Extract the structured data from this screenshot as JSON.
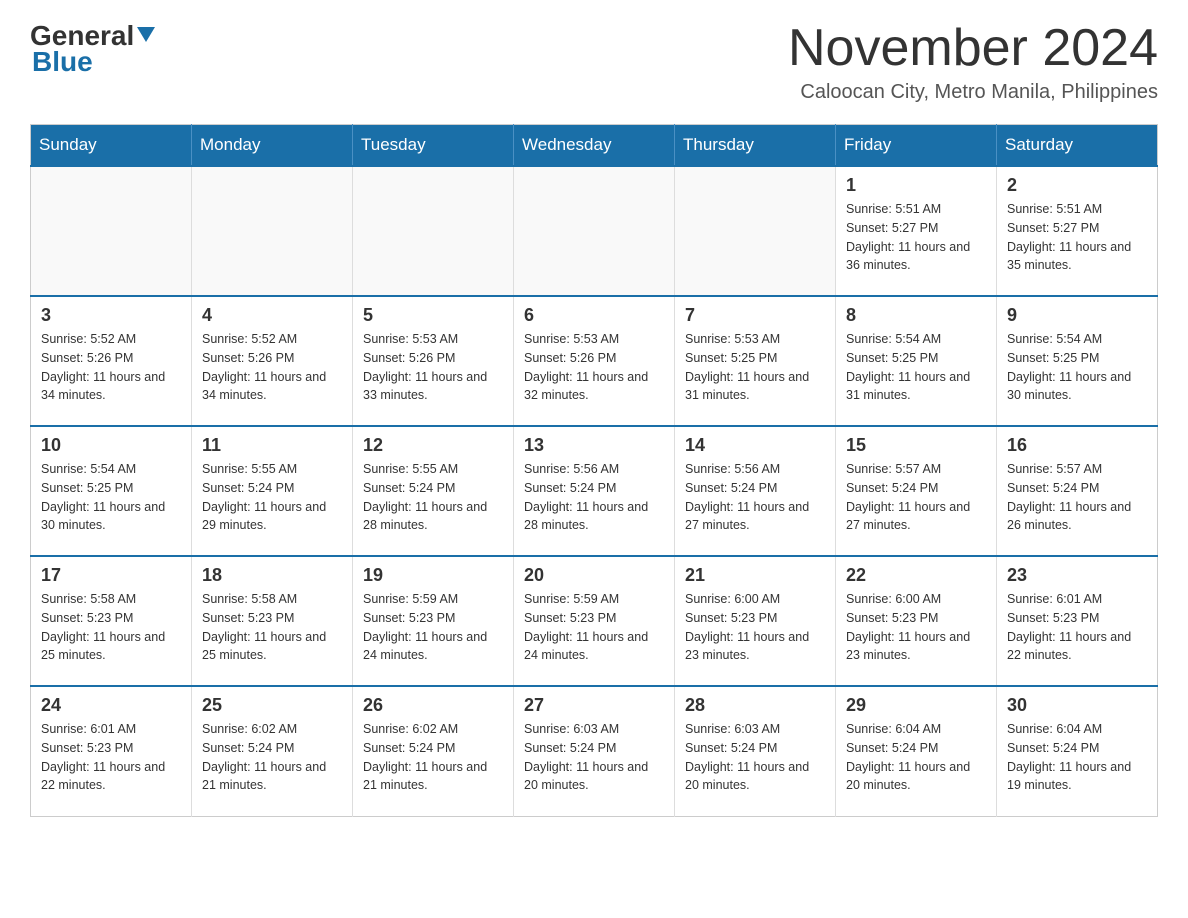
{
  "logo": {
    "text_general": "General",
    "text_blue": "Blue"
  },
  "title": "November 2024",
  "subtitle": "Caloocan City, Metro Manila, Philippines",
  "weekdays": [
    "Sunday",
    "Monday",
    "Tuesday",
    "Wednesday",
    "Thursday",
    "Friday",
    "Saturday"
  ],
  "weeks": [
    [
      {
        "day": "",
        "info": ""
      },
      {
        "day": "",
        "info": ""
      },
      {
        "day": "",
        "info": ""
      },
      {
        "day": "",
        "info": ""
      },
      {
        "day": "",
        "info": ""
      },
      {
        "day": "1",
        "info": "Sunrise: 5:51 AM\nSunset: 5:27 PM\nDaylight: 11 hours and 36 minutes."
      },
      {
        "day": "2",
        "info": "Sunrise: 5:51 AM\nSunset: 5:27 PM\nDaylight: 11 hours and 35 minutes."
      }
    ],
    [
      {
        "day": "3",
        "info": "Sunrise: 5:52 AM\nSunset: 5:26 PM\nDaylight: 11 hours and 34 minutes."
      },
      {
        "day": "4",
        "info": "Sunrise: 5:52 AM\nSunset: 5:26 PM\nDaylight: 11 hours and 34 minutes."
      },
      {
        "day": "5",
        "info": "Sunrise: 5:53 AM\nSunset: 5:26 PM\nDaylight: 11 hours and 33 minutes."
      },
      {
        "day": "6",
        "info": "Sunrise: 5:53 AM\nSunset: 5:26 PM\nDaylight: 11 hours and 32 minutes."
      },
      {
        "day": "7",
        "info": "Sunrise: 5:53 AM\nSunset: 5:25 PM\nDaylight: 11 hours and 31 minutes."
      },
      {
        "day": "8",
        "info": "Sunrise: 5:54 AM\nSunset: 5:25 PM\nDaylight: 11 hours and 31 minutes."
      },
      {
        "day": "9",
        "info": "Sunrise: 5:54 AM\nSunset: 5:25 PM\nDaylight: 11 hours and 30 minutes."
      }
    ],
    [
      {
        "day": "10",
        "info": "Sunrise: 5:54 AM\nSunset: 5:25 PM\nDaylight: 11 hours and 30 minutes."
      },
      {
        "day": "11",
        "info": "Sunrise: 5:55 AM\nSunset: 5:24 PM\nDaylight: 11 hours and 29 minutes."
      },
      {
        "day": "12",
        "info": "Sunrise: 5:55 AM\nSunset: 5:24 PM\nDaylight: 11 hours and 28 minutes."
      },
      {
        "day": "13",
        "info": "Sunrise: 5:56 AM\nSunset: 5:24 PM\nDaylight: 11 hours and 28 minutes."
      },
      {
        "day": "14",
        "info": "Sunrise: 5:56 AM\nSunset: 5:24 PM\nDaylight: 11 hours and 27 minutes."
      },
      {
        "day": "15",
        "info": "Sunrise: 5:57 AM\nSunset: 5:24 PM\nDaylight: 11 hours and 27 minutes."
      },
      {
        "day": "16",
        "info": "Sunrise: 5:57 AM\nSunset: 5:24 PM\nDaylight: 11 hours and 26 minutes."
      }
    ],
    [
      {
        "day": "17",
        "info": "Sunrise: 5:58 AM\nSunset: 5:23 PM\nDaylight: 11 hours and 25 minutes."
      },
      {
        "day": "18",
        "info": "Sunrise: 5:58 AM\nSunset: 5:23 PM\nDaylight: 11 hours and 25 minutes."
      },
      {
        "day": "19",
        "info": "Sunrise: 5:59 AM\nSunset: 5:23 PM\nDaylight: 11 hours and 24 minutes."
      },
      {
        "day": "20",
        "info": "Sunrise: 5:59 AM\nSunset: 5:23 PM\nDaylight: 11 hours and 24 minutes."
      },
      {
        "day": "21",
        "info": "Sunrise: 6:00 AM\nSunset: 5:23 PM\nDaylight: 11 hours and 23 minutes."
      },
      {
        "day": "22",
        "info": "Sunrise: 6:00 AM\nSunset: 5:23 PM\nDaylight: 11 hours and 23 minutes."
      },
      {
        "day": "23",
        "info": "Sunrise: 6:01 AM\nSunset: 5:23 PM\nDaylight: 11 hours and 22 minutes."
      }
    ],
    [
      {
        "day": "24",
        "info": "Sunrise: 6:01 AM\nSunset: 5:23 PM\nDaylight: 11 hours and 22 minutes."
      },
      {
        "day": "25",
        "info": "Sunrise: 6:02 AM\nSunset: 5:24 PM\nDaylight: 11 hours and 21 minutes."
      },
      {
        "day": "26",
        "info": "Sunrise: 6:02 AM\nSunset: 5:24 PM\nDaylight: 11 hours and 21 minutes."
      },
      {
        "day": "27",
        "info": "Sunrise: 6:03 AM\nSunset: 5:24 PM\nDaylight: 11 hours and 20 minutes."
      },
      {
        "day": "28",
        "info": "Sunrise: 6:03 AM\nSunset: 5:24 PM\nDaylight: 11 hours and 20 minutes."
      },
      {
        "day": "29",
        "info": "Sunrise: 6:04 AM\nSunset: 5:24 PM\nDaylight: 11 hours and 20 minutes."
      },
      {
        "day": "30",
        "info": "Sunrise: 6:04 AM\nSunset: 5:24 PM\nDaylight: 11 hours and 19 minutes."
      }
    ]
  ]
}
